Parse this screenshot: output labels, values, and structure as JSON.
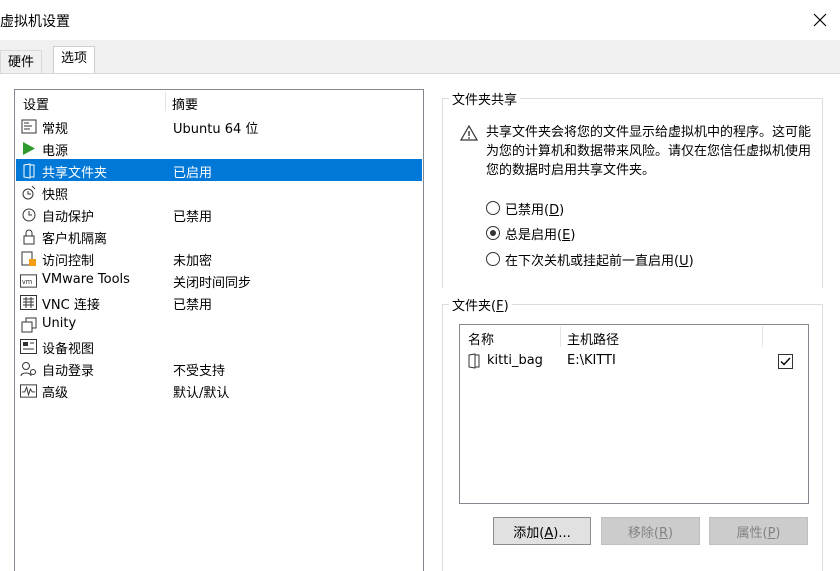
{
  "window": {
    "title": "虚拟机设置",
    "close_icon": "close-icon"
  },
  "tabs": [
    {
      "label": "硬件"
    },
    {
      "label": "选项"
    }
  ],
  "settings": {
    "col_setting": "设置",
    "col_summary": "摘要",
    "items": [
      {
        "label": "常规",
        "summary": "Ubuntu 64 位",
        "icon": "general-icon"
      },
      {
        "label": "电源",
        "summary": "",
        "icon": "power-play-icon"
      },
      {
        "label": "共享文件夹",
        "summary": "已启用",
        "icon": "shared-folder-icon",
        "selected": true
      },
      {
        "label": "快照",
        "summary": "",
        "icon": "snapshot-icon"
      },
      {
        "label": "自动保护",
        "summary": "已禁用",
        "icon": "clock-icon"
      },
      {
        "label": "客户机隔离",
        "summary": "",
        "icon": "lock-icon"
      },
      {
        "label": "访问控制",
        "summary": "未加密",
        "icon": "access-control-icon"
      },
      {
        "label": "VMware Tools",
        "summary": "关闭时间同步",
        "icon": "vm-tools-icon"
      },
      {
        "label": "VNC 连接",
        "summary": "已禁用",
        "icon": "vnc-icon"
      },
      {
        "label": "Unity",
        "summary": "",
        "icon": "unity-icon"
      },
      {
        "label": "设备视图",
        "summary": "",
        "icon": "device-view-icon"
      },
      {
        "label": "自动登录",
        "summary": "不受支持",
        "icon": "autologin-icon"
      },
      {
        "label": "高级",
        "summary": "默认/默认",
        "icon": "advanced-icon"
      }
    ]
  },
  "sharing": {
    "title": "文件夹共享",
    "warning": "共享文件夹会将您的文件显示给虚拟机中的程序。这可能为您的计算机和数据带来风险。请仅在您信任虚拟机使用您的数据时启用共享文件夹。",
    "options": [
      {
        "label": "已禁用",
        "key": "D",
        "checked": false
      },
      {
        "label": "总是启用",
        "key": "E",
        "checked": true
      },
      {
        "label": "在下次关机或挂起前一直启用",
        "key": "U",
        "checked": false
      }
    ]
  },
  "folders": {
    "title": "文件夹",
    "title_key": "F",
    "col_name": "名称",
    "col_path": "主机路径",
    "rows": [
      {
        "name": "kitti_bag",
        "path": "E:\\KITTI",
        "enabled": true
      }
    ],
    "btn_add": "添加",
    "btn_add_key": "A",
    "btn_add_suffix": "...",
    "btn_remove": "移除",
    "btn_remove_key": "R",
    "btn_props": "属性",
    "btn_props_key": "P"
  }
}
